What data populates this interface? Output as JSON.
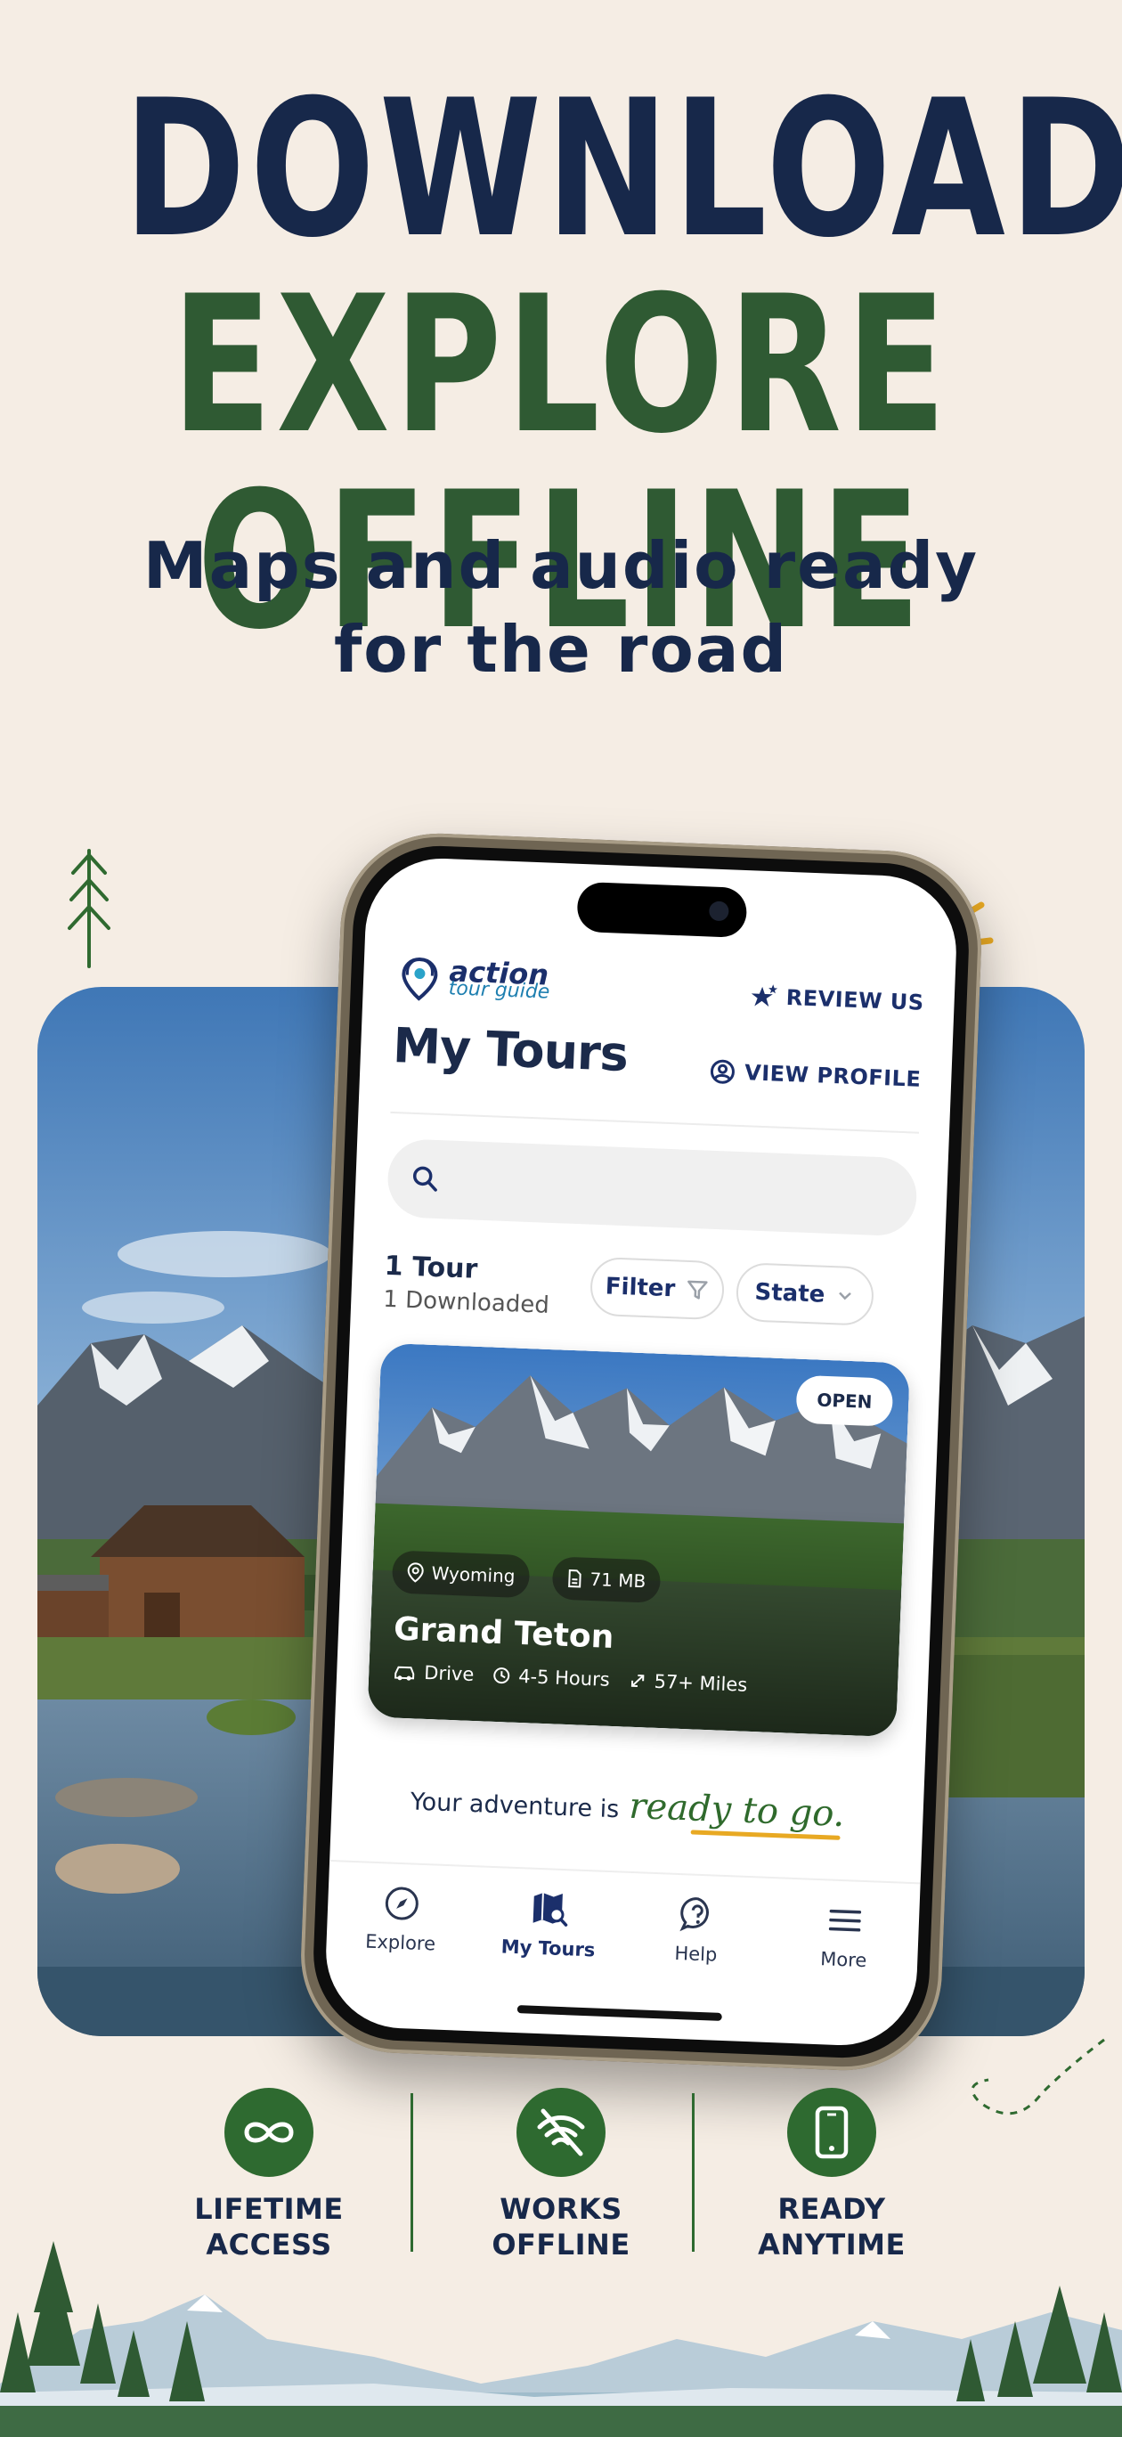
{
  "headline": {
    "line1": "DOWNLOAD",
    "line2": "EXPLORE OFFLINE",
    "subtitle_line1": "Maps and audio ready",
    "subtitle_line2": "for the road"
  },
  "colors": {
    "navy": "#17284a",
    "forest_green": "#2f5a33",
    "background": "#f5ede4",
    "accent_yellow": "#e8a923"
  },
  "app": {
    "logo": {
      "word1": "action",
      "word2": "tour guide",
      "icon": "map-pin-headphones-icon"
    },
    "review_button": {
      "label": "REVIEW US",
      "icon": "star-sparkle-icon"
    },
    "page_title": "My Tours",
    "profile_button": {
      "label": "VIEW PROFILE",
      "icon": "user-circle-icon"
    },
    "search": {
      "placeholder": "",
      "value": "",
      "icon": "search-icon"
    },
    "summary": {
      "count": "1 Tour",
      "downloaded": "1 Downloaded"
    },
    "filter_button": {
      "label": "Filter",
      "icon": "funnel-icon"
    },
    "state_select": {
      "label": "State",
      "icon": "chevron-down-icon"
    },
    "tours": [
      {
        "name": "Grand Teton",
        "open_label": "OPEN",
        "state": "Wyoming",
        "size": "71 MB",
        "mode": "Drive",
        "duration": "4-5 Hours",
        "distance": "57+ Miles"
      }
    ],
    "ready_message": {
      "plain": "Your adventure is",
      "script": "ready to go."
    },
    "tabs": [
      {
        "label": "Explore",
        "icon": "compass-icon",
        "active": false
      },
      {
        "label": "My Tours",
        "icon": "map-search-icon",
        "active": true
      },
      {
        "label": "Help",
        "icon": "question-icon",
        "active": false
      },
      {
        "label": "More",
        "icon": "menu-icon",
        "active": false
      }
    ]
  },
  "features": [
    {
      "line1": "LIFETIME",
      "line2": "ACCESS",
      "icon": "infinity-icon"
    },
    {
      "line1": "WORKS",
      "line2": "OFFLINE",
      "icon": "wifi-off-icon"
    },
    {
      "line1": "READY",
      "line2": "ANYTIME",
      "icon": "smartphone-icon"
    }
  ]
}
